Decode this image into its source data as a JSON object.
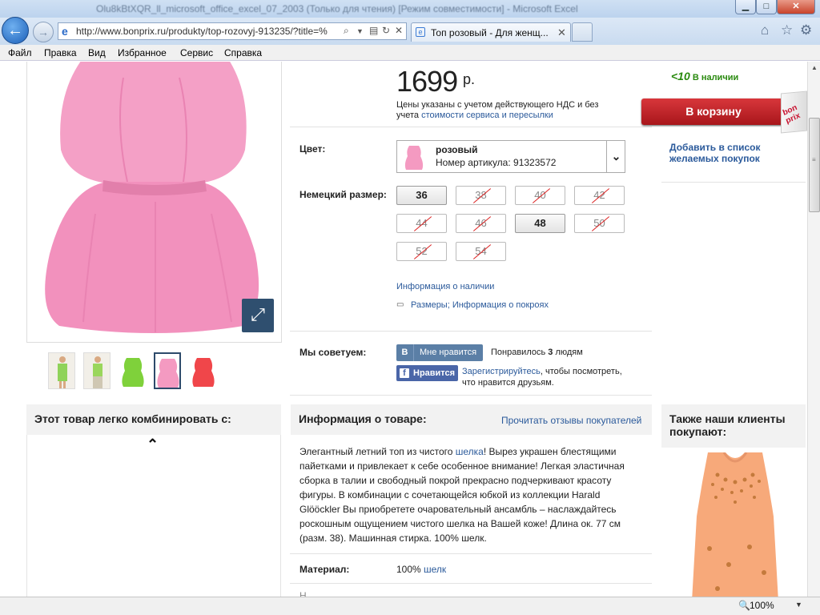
{
  "browser": {
    "title": "Olu8kBtXQR_ll_microsoft_office_excel_07_2003 (Только для чтения) [Режим совместимости] - Microsoft Excel",
    "url": "http://www.bonprix.ru/produkty/top-rozovyj-913235/?title=%",
    "tab_title": "Топ розовый - Для женщ...",
    "back_icon": "back-arrow-icon",
    "forward_icon": "forward-arrow-icon",
    "menu": [
      "Файл",
      "Правка",
      "Вид",
      "Избранное",
      "Сервис",
      "Справка"
    ],
    "zoom": "100%"
  },
  "product": {
    "price": "1699",
    "currency": "р.",
    "vat_note": "Цены указаны с учетом действующего НДС и без учета ",
    "vat_link": "стоимости сервиса и пересылки",
    "stock_num": "<10",
    "stock_text": "В наличии",
    "cart_button": "В корзину",
    "bag_logo": "bon prix",
    "wishlist": "Добавить в список желаемых покупок",
    "color_label": "Цвет:",
    "color_name": "розовый",
    "article": "Номер артикула: 91323572",
    "size_label": "Немецкий размер:",
    "sizes": [
      {
        "label": "36",
        "available": true
      },
      {
        "label": "38",
        "available": false
      },
      {
        "label": "40",
        "available": false
      },
      {
        "label": "42",
        "available": false
      },
      {
        "label": "44",
        "available": false
      },
      {
        "label": "46",
        "available": false
      },
      {
        "label": "48",
        "available": true
      },
      {
        "label": "50",
        "available": false
      },
      {
        "label": "52",
        "available": false
      },
      {
        "label": "54",
        "available": false
      }
    ],
    "stock_info": "Информация о наличии",
    "sizes_info": "Размеры; Информация о покроях"
  },
  "social": {
    "recommend_label": "Мы советуем:",
    "vk_logo": "В",
    "vk_button": "Мне нравится",
    "vk_count_pre": "Понравилось ",
    "vk_count_num": "3",
    "vk_count_post": " людям",
    "fb_button": "Нравится",
    "fb_link": "Зарегистрируйтесь",
    "fb_text": ", чтобы посмотреть, что нравится друзьям."
  },
  "sections": {
    "combine_title": "Этот товар легко комбинировать с:",
    "info_title": "Информация о товаре:",
    "reviews_link": "Прочитать отзывы покупателей",
    "also_title": "Также наши клиенты покупают:",
    "description_pre": "Элегантный летний топ из чистого ",
    "description_link": "шелка",
    "description_post": "! Вырез украшен блестящими пайетками и привлекает к себе особенное внимание! Легкая эластичная сборка в талии и свободный покрой прекрасно подчеркивают красоту фигуры. В комбинации с сочетающейся юбкой из коллекции Harald Glööckler Вы приобретете очаровательный ансамбль – наслаждайтесь роскошным ощущением чистого шелка на Вашей коже! Длина ок. 77 см (разм. 38). Машинная стирка. 100% шелк.",
    "material_label": "Материал:",
    "material_pct": "100% ",
    "material_link": "шелк",
    "next_row": "Н..."
  },
  "thumbnails": [
    {
      "name": "thumb-model-green-dress",
      "color": "#8fd35a"
    },
    {
      "name": "thumb-model-green-top",
      "color": "#9ad65c"
    },
    {
      "name": "thumb-green-top",
      "color": "#7fd13b"
    },
    {
      "name": "thumb-pink-top",
      "color": "#f49ac1"
    },
    {
      "name": "thumb-red-top",
      "color": "#f0464a"
    }
  ],
  "colors": {
    "accent": "#2b5a9b",
    "cart": "#c8202a",
    "stock": "#2a8a0f",
    "vk": "#5b7fa6",
    "fb": "#4a66a8",
    "product": "#f49ac1"
  }
}
